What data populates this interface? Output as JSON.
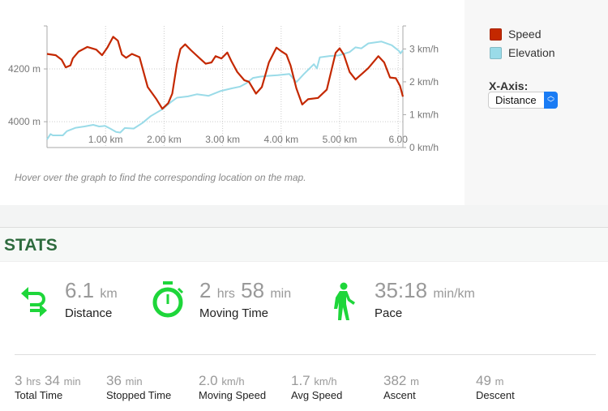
{
  "chart_data": {
    "type": "line",
    "xlabel": "",
    "x_ticks": [
      "1.00 km",
      "2.00 km",
      "3.00 km",
      "4.00 km",
      "5.00 km",
      "6.00"
    ],
    "x_tick_values": [
      1,
      2,
      3,
      4,
      5,
      6
    ],
    "xlim": [
      0,
      6.08
    ],
    "y_left_ticks": [
      "4000 m",
      "4200 m"
    ],
    "y_left_tick_values": [
      4000,
      4200
    ],
    "y_left_lim": [
      3902,
      4363
    ],
    "y_right_ticks": [
      "0 km/h",
      "1 km/h",
      "2 km/h",
      "3 km/h"
    ],
    "y_right_tick_values": [
      0,
      1,
      2,
      3
    ],
    "y_right_lim": [
      0,
      3.7
    ],
    "grid": true,
    "legend": "right",
    "series": [
      {
        "name": "Speed",
        "axis": "right",
        "color": "#c42800",
        "points": [
          [
            0,
            2.85
          ],
          [
            0.15,
            2.81
          ],
          [
            0.25,
            2.67
          ],
          [
            0.32,
            2.44
          ],
          [
            0.4,
            2.5
          ],
          [
            0.44,
            2.71
          ],
          [
            0.54,
            2.92
          ],
          [
            0.69,
            3.06
          ],
          [
            0.84,
            2.98
          ],
          [
            0.94,
            2.81
          ],
          [
            1.03,
            3.04
          ],
          [
            1.13,
            3.37
          ],
          [
            1.21,
            3.25
          ],
          [
            1.28,
            2.83
          ],
          [
            1.35,
            2.73
          ],
          [
            1.45,
            2.85
          ],
          [
            1.58,
            2.75
          ],
          [
            1.65,
            2.3
          ],
          [
            1.72,
            1.84
          ],
          [
            1.87,
            1.47
          ],
          [
            1.97,
            1.18
          ],
          [
            2.07,
            1.35
          ],
          [
            2.14,
            1.64
          ],
          [
            2.22,
            2.55
          ],
          [
            2.28,
            3.0
          ],
          [
            2.36,
            3.14
          ],
          [
            2.46,
            2.96
          ],
          [
            2.61,
            2.71
          ],
          [
            2.71,
            2.55
          ],
          [
            2.81,
            2.59
          ],
          [
            2.88,
            2.78
          ],
          [
            2.98,
            2.71
          ],
          [
            3.08,
            2.89
          ],
          [
            3.15,
            2.63
          ],
          [
            3.25,
            2.3
          ],
          [
            3.37,
            2.05
          ],
          [
            3.45,
            2.0
          ],
          [
            3.57,
            1.64
          ],
          [
            3.67,
            1.84
          ],
          [
            3.79,
            2.59
          ],
          [
            3.92,
            3.04
          ],
          [
            4.01,
            2.92
          ],
          [
            4.09,
            2.83
          ],
          [
            4.16,
            2.5
          ],
          [
            4.26,
            1.8
          ],
          [
            4.36,
            1.31
          ],
          [
            4.46,
            1.47
          ],
          [
            4.63,
            1.51
          ],
          [
            4.78,
            1.76
          ],
          [
            4.93,
            2.88
          ],
          [
            5.0,
            3.02
          ],
          [
            5.07,
            2.83
          ],
          [
            5.17,
            2.3
          ],
          [
            5.27,
            2.07
          ],
          [
            5.39,
            2.26
          ],
          [
            5.49,
            2.42
          ],
          [
            5.66,
            2.78
          ],
          [
            5.76,
            2.59
          ],
          [
            5.86,
            2.13
          ],
          [
            5.96,
            2.11
          ],
          [
            6.03,
            1.88
          ],
          [
            6.08,
            1.55
          ]
        ]
      },
      {
        "name": "Elevation",
        "axis": "left",
        "color": "#9adbe8",
        "points": [
          [
            0,
            3933
          ],
          [
            0.06,
            3953
          ],
          [
            0.1,
            3948
          ],
          [
            0.27,
            3948
          ],
          [
            0.34,
            3964
          ],
          [
            0.49,
            3977
          ],
          [
            0.64,
            3982
          ],
          [
            0.79,
            3988
          ],
          [
            0.89,
            3982
          ],
          [
            0.99,
            3984
          ],
          [
            1.08,
            3974
          ],
          [
            1.18,
            3961
          ],
          [
            1.25,
            3959
          ],
          [
            1.33,
            3976
          ],
          [
            1.48,
            3974
          ],
          [
            1.63,
            3995
          ],
          [
            1.77,
            4021
          ],
          [
            1.97,
            4047
          ],
          [
            2.12,
            4075
          ],
          [
            2.22,
            4091
          ],
          [
            2.41,
            4096
          ],
          [
            2.56,
            4104
          ],
          [
            2.76,
            4098
          ],
          [
            2.96,
            4116
          ],
          [
            3.15,
            4126
          ],
          [
            3.3,
            4133
          ],
          [
            3.4,
            4145
          ],
          [
            3.52,
            4166
          ],
          [
            3.65,
            4171
          ],
          [
            3.79,
            4174
          ],
          [
            3.94,
            4176
          ],
          [
            4.14,
            4181
          ],
          [
            4.26,
            4150
          ],
          [
            4.39,
            4181
          ],
          [
            4.56,
            4218
          ],
          [
            4.61,
            4202
          ],
          [
            4.66,
            4244
          ],
          [
            4.83,
            4249
          ],
          [
            4.98,
            4251
          ],
          [
            5.17,
            4264
          ],
          [
            5.27,
            4282
          ],
          [
            5.37,
            4278
          ],
          [
            5.49,
            4297
          ],
          [
            5.71,
            4304
          ],
          [
            5.89,
            4290
          ],
          [
            6.01,
            4269
          ],
          [
            6.04,
            4259
          ],
          [
            6.08,
            4271
          ]
        ]
      }
    ]
  },
  "legend": {
    "speed": "Speed",
    "elevation": "Elevation",
    "speed_color": "#c42800",
    "elevation_color": "#9adbe8"
  },
  "xaxis": {
    "label": "X-Axis:",
    "selected": "Distance"
  },
  "hint": "Hover over the graph to find the corresponding location on the map.",
  "stats": {
    "title": "STATS",
    "accent": "#1ed63a",
    "distance": {
      "value": "6.1",
      "unit": "km",
      "label": "Distance",
      "icon": "arrows-loop-icon"
    },
    "moving_time": {
      "h": "2",
      "h_unit": "hrs",
      "m": "58",
      "m_unit": "min",
      "label": "Moving Time",
      "icon": "stopwatch-icon"
    },
    "pace": {
      "value": "35:18",
      "unit": "min/km",
      "label": "Pace",
      "icon": "walking-person-icon"
    },
    "total_time": {
      "h": "3",
      "h_unit": "hrs",
      "m": "34",
      "m_unit": "min",
      "label": "Total Time"
    },
    "stopped_time": {
      "value": "36",
      "unit": "min",
      "label": "Stopped Time"
    },
    "moving_speed": {
      "value": "2.0",
      "unit": "km/h",
      "label": "Moving Speed"
    },
    "avg_speed": {
      "value": "1.7",
      "unit": "km/h",
      "label": "Avg Speed"
    },
    "ascent": {
      "value": "382",
      "unit": "m",
      "label": "Ascent"
    },
    "descent": {
      "value": "49",
      "unit": "m",
      "label": "Descent"
    }
  }
}
